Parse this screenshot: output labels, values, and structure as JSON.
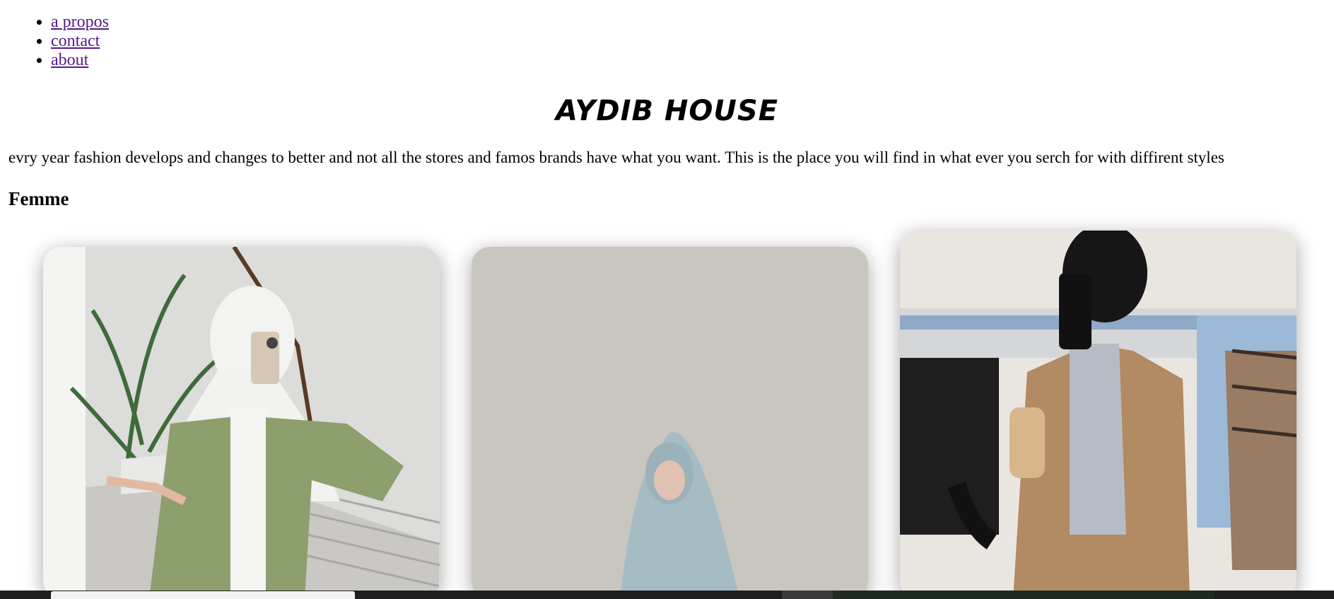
{
  "nav": {
    "items": [
      "a propos",
      "contact",
      "about"
    ]
  },
  "page": {
    "title": "AYDIB HOUSE",
    "intro": "evry year fashion develops and changes to better and not all the stores and famos brands have what you want. This is the place you will find in what ever you serch for with diffirent styles",
    "section": "Femme"
  },
  "colors": {
    "link": "#551a8b",
    "taskbar": "#1f1f1f"
  }
}
